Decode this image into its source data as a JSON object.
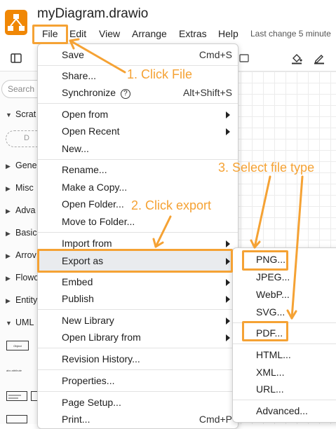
{
  "app": {
    "title": "myDiagram.drawio",
    "last_change": "Last change 5 minute",
    "brand_color": "#f08705",
    "logo_icon": "drawio-logo"
  },
  "menubar": {
    "items": [
      "File",
      "Edit",
      "View",
      "Arrange",
      "Extras",
      "Help"
    ]
  },
  "toolbar": {
    "icons": [
      "sidebar-toggle-icon",
      "rectangle-icon",
      "fill-color-icon",
      "line-color-icon"
    ]
  },
  "sidebar": {
    "search_placeholder": "Search",
    "button_label": "D",
    "sections": [
      "Scrat",
      "Gene",
      "Misc",
      "Adva",
      "Basic",
      "Arrov",
      "Flowc",
      "Entity",
      "UML"
    ],
    "shape_labels": [
      "Object",
      "abc attribute"
    ]
  },
  "file_menu": {
    "items": [
      {
        "label": "Save",
        "shortcut": "Cmd+S"
      },
      {
        "label": "Share..."
      },
      {
        "label": "Synchronize",
        "shortcut": "Alt+Shift+S",
        "help_glyph": "?"
      },
      {
        "label": "Open from"
      },
      {
        "label": "Open Recent"
      },
      {
        "label": "New..."
      },
      {
        "label": "Rename..."
      },
      {
        "label": "Make a Copy..."
      },
      {
        "label": "Open Folder..."
      },
      {
        "label": "Move to Folder..."
      },
      {
        "label": "Import from"
      },
      {
        "label": "Export as"
      },
      {
        "label": "Embed"
      },
      {
        "label": "Publish"
      },
      {
        "label": "New Library"
      },
      {
        "label": "Open Library from"
      },
      {
        "label": "Revision History..."
      },
      {
        "label": "Properties..."
      },
      {
        "label": "Page Setup..."
      },
      {
        "label": "Print...",
        "shortcut": "Cmd+P"
      }
    ]
  },
  "export_submenu": {
    "items": [
      "PNG...",
      "JPEG...",
      "WebP...",
      "SVG...",
      "PDF...",
      "HTML...",
      "XML...",
      "URL...",
      "Advanced..."
    ]
  },
  "annotations": {
    "step1": "1. Click File",
    "step2": "2. Click export",
    "step3": "3. Select file type",
    "color": "#f5a234"
  }
}
